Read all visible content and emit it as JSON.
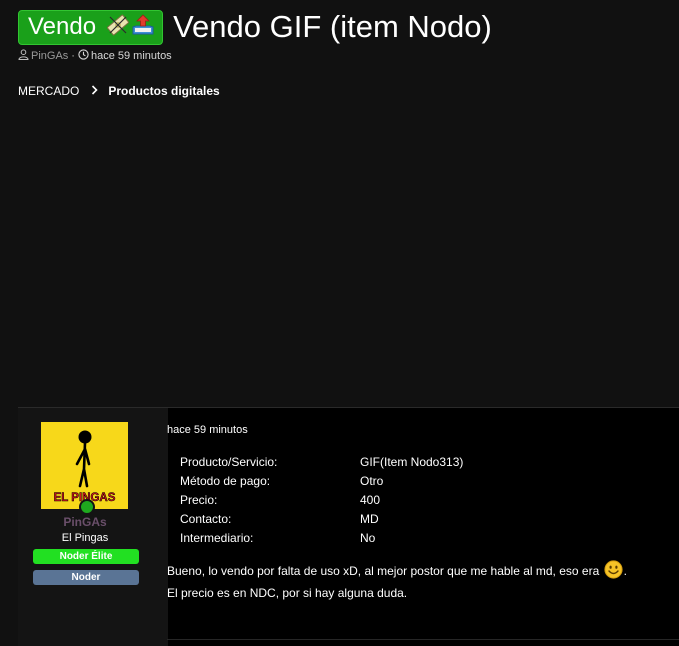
{
  "thread": {
    "prefix_label": "Vendo",
    "title": "Vendo GIF (item Nodo)",
    "author": "PinGAs",
    "separator": "·",
    "time": "hace 59 minutos"
  },
  "breadcrumb": {
    "parent": "MERCADO",
    "current": "Productos digitales"
  },
  "post": {
    "username": "PinGAs",
    "user_title": "El Pingas",
    "avatar_caption": "EL PINGAS",
    "banners": [
      "Noder Élite",
      "Noder"
    ],
    "time": "hace 59 minutos",
    "fields": [
      {
        "label": "Producto/Servicio:",
        "value": "GIF(Item Nodo313)"
      },
      {
        "label": "Método de pago:",
        "value": "Otro"
      },
      {
        "label": "Precio:",
        "value": "400"
      },
      {
        "label": "Contacto:",
        "value": "MD"
      },
      {
        "label": "Intermediario:",
        "value": "No"
      }
    ],
    "body_line1_before": "Bueno, lo vendo por falta de uso xD, al mejor postor que me hable al md, eso era ",
    "body_line1_after": ".",
    "body_line2": "El precio es en NDC, por si hay alguna duda."
  },
  "colors": {
    "background": "#111111",
    "prefix_green": "#1aa01a",
    "banner_elite": "#22e022",
    "banner_noder": "#5a7495",
    "avatar_yellow": "#f7d81a"
  }
}
